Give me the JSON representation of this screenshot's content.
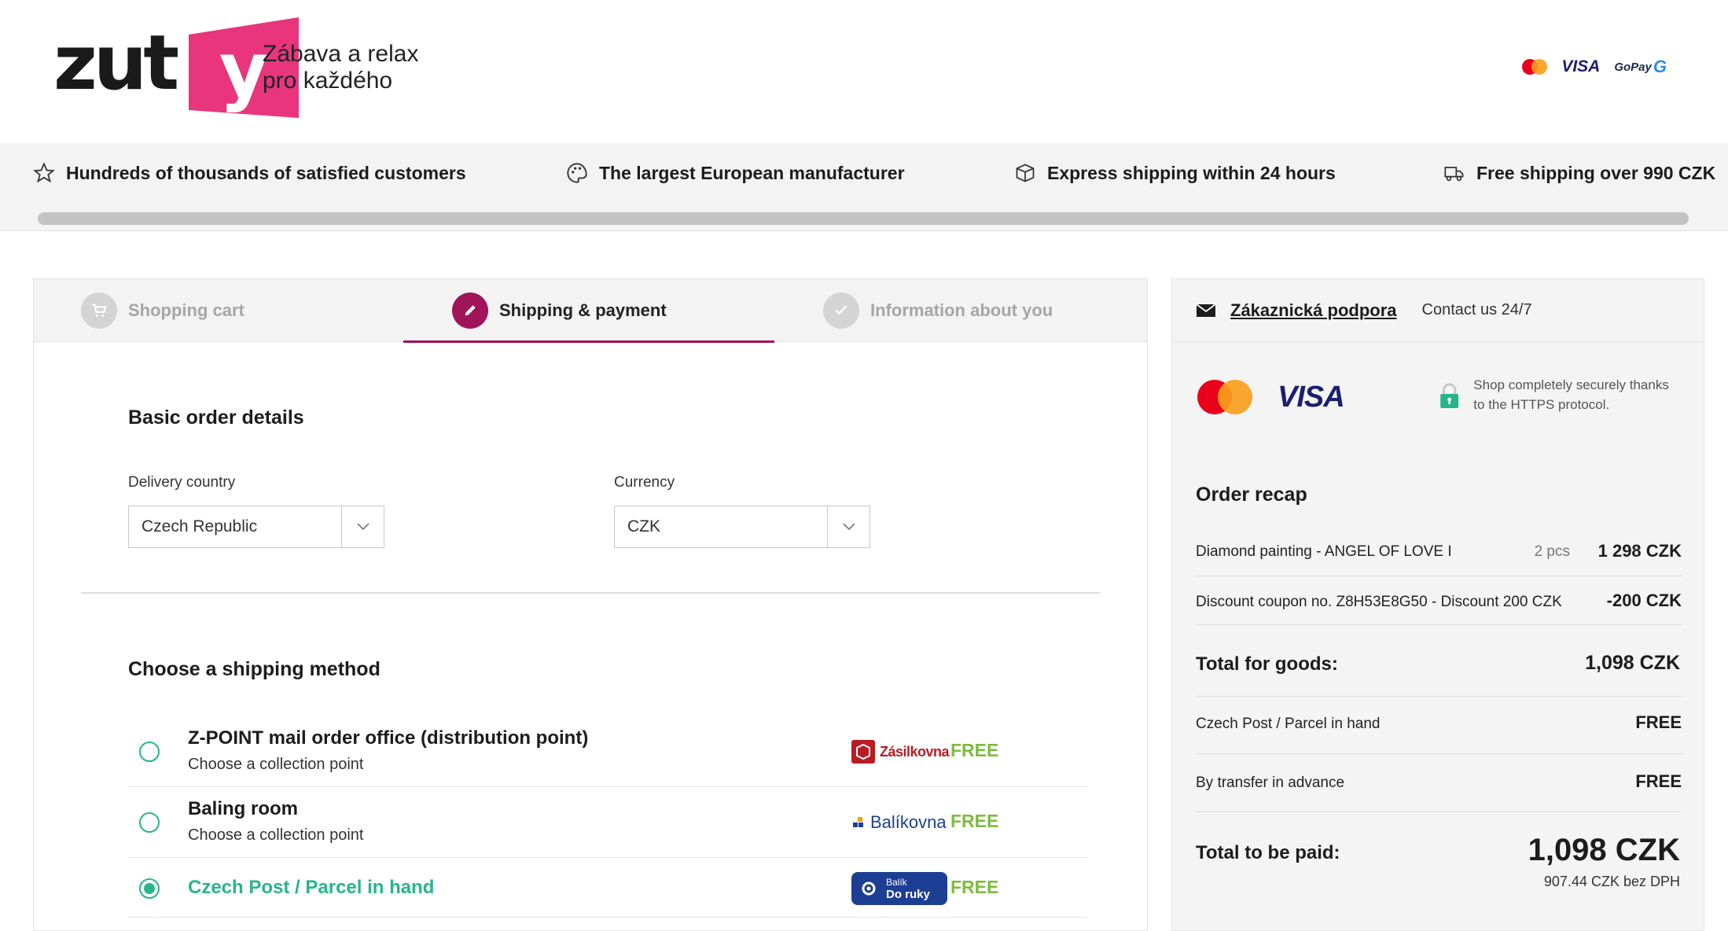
{
  "header": {
    "logo_text": "zut",
    "logo_y": "y",
    "tagline_line1": "Zábava a relax",
    "tagline_line2": "pro každého",
    "payment_icons": [
      "mastercard-icon",
      "visa-icon",
      "gopay-icon"
    ],
    "visa_label": "VISA",
    "gopay_label": "GoPay"
  },
  "benefits": [
    {
      "icon": "star-icon",
      "text": "Hundreds of thousands of satisfied customers"
    },
    {
      "icon": "palette-icon",
      "text": "The largest European manufacturer"
    },
    {
      "icon": "box-icon",
      "text": "Express shipping within 24 hours"
    },
    {
      "icon": "truck-icon",
      "text": "Free shipping over 990 CZK"
    }
  ],
  "steps": [
    {
      "label": "Shopping cart",
      "state": "done",
      "icon": "cart-icon"
    },
    {
      "label": "Shipping & payment",
      "state": "active",
      "icon": "pencil-icon"
    },
    {
      "label": "Information about you",
      "state": "pending",
      "icon": "check-icon"
    }
  ],
  "basic": {
    "title": "Basic order details",
    "country_label": "Delivery country",
    "country_value": "Czech Republic",
    "currency_label": "Currency",
    "currency_value": "CZK"
  },
  "shipping": {
    "title": "Choose a shipping method",
    "options": [
      {
        "name": "Z-POINT mail order office (distribution point)",
        "sub": "Choose a collection point",
        "carrier": "Zásilkovna",
        "price": "FREE",
        "selected": false
      },
      {
        "name": "Baling room",
        "sub": "Choose a collection point",
        "carrier": "Balíkovna",
        "price": "FREE",
        "selected": false
      },
      {
        "name": "Czech Post / Parcel in hand",
        "sub": "",
        "carrier_line1": "Balík",
        "carrier_line2": "Do ruky",
        "price": "FREE",
        "selected": true
      }
    ]
  },
  "sidebar": {
    "support_link": "Zákaznická podpora",
    "contact": "Contact us 24/7",
    "visa_label": "VISA",
    "secure_text": "Shop completely securely thanks to the HTTPS protocol.",
    "recap_title": "Order recap",
    "items": [
      {
        "label": "Diamond painting - ANGEL OF LOVE I",
        "qty": "2 pcs",
        "price": "1 298 CZK"
      },
      {
        "label": "Discount coupon no. Z8H53E8G50 - Discount 200 CZK",
        "qty": "",
        "price": "-200 CZK"
      }
    ],
    "goods_label": "Total for goods:",
    "goods_value": "1,098 CZK",
    "shipping_label": "Czech Post / Parcel in hand",
    "shipping_value": "FREE",
    "payment_label": "By transfer in advance",
    "payment_value": "FREE",
    "total_label": "Total to be paid:",
    "total_value": "1,098 CZK",
    "vat_note": "907.44 CZK bez DPH"
  },
  "colors": {
    "brand_pink": "#e8357c",
    "accent_purple": "#a0145a",
    "selected_green": "#27b58c",
    "free_green": "#7dbb3e"
  }
}
